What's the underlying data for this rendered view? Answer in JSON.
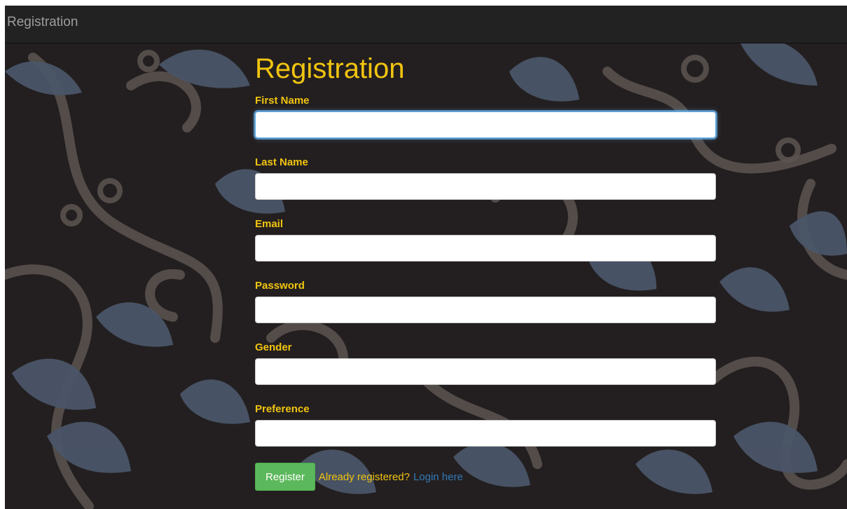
{
  "navbar": {
    "brand": "Registration"
  },
  "form": {
    "heading": "Registration",
    "fields": [
      {
        "label": "First Name",
        "value": ""
      },
      {
        "label": "Last Name",
        "value": ""
      },
      {
        "label": "Email",
        "value": ""
      },
      {
        "label": "Password",
        "value": ""
      },
      {
        "label": "Gender",
        "value": ""
      },
      {
        "label": "Preference",
        "value": ""
      }
    ],
    "register_label": "Register",
    "already_text": "Already registered?",
    "login_link": "Login here"
  },
  "colors": {
    "accent_yellow": "#f1c40f",
    "navbar": "#222222",
    "background": "#231f20",
    "leaf_blue": "#4a5568",
    "swirl_gray": "#5c5551",
    "button_green": "#5cb85c",
    "link_blue": "#337ab7"
  }
}
